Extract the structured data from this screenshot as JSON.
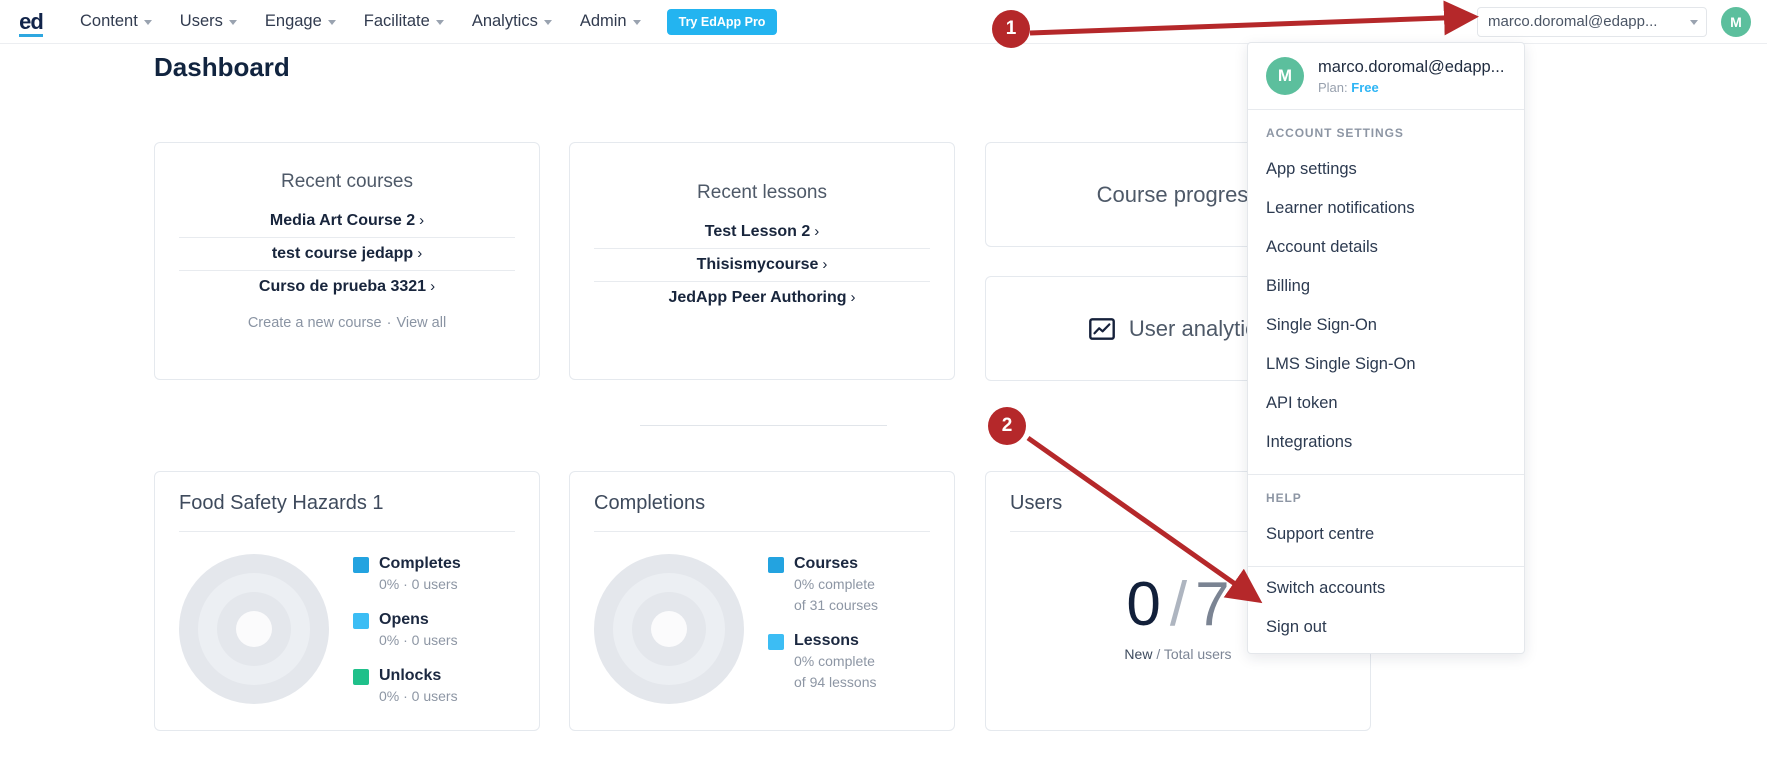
{
  "nav": {
    "logo": "ed",
    "items": [
      {
        "label": "Content",
        "has_caret": true
      },
      {
        "label": "Users",
        "has_caret": true
      },
      {
        "label": "Engage",
        "has_caret": true
      },
      {
        "label": "Facilitate",
        "has_caret": true
      },
      {
        "label": "Analytics",
        "has_caret": true
      },
      {
        "label": "Admin",
        "has_caret": true
      }
    ],
    "try_pro": "Try EdApp Pro",
    "account_selector_value": "marco.doromal@edapp...",
    "avatar_initial": "M"
  },
  "page": {
    "title": "Dashboard"
  },
  "recent_courses": {
    "heading": "Recent courses",
    "items": [
      {
        "label": "Media Art Course 2"
      },
      {
        "label": "test course jedapp"
      },
      {
        "label": "Curso de prueba 3321"
      }
    ],
    "create_link": "Create a new course",
    "separator": "·",
    "view_all_link": "View all"
  },
  "recent_lessons": {
    "heading": "Recent lessons",
    "items": [
      {
        "label": "Test Lesson 2"
      },
      {
        "label": "Thisismycourse"
      },
      {
        "label": "JedApp Peer Authoring"
      }
    ]
  },
  "course_progress": {
    "heading": "Course progress"
  },
  "user_analytics": {
    "heading": "User analytics",
    "icon": "chart-icon"
  },
  "food_safety": {
    "heading": "Food Safety Hazards 1",
    "legend": [
      {
        "label": "Completes",
        "sub": "0% · 0 users",
        "color": "#23a3e0"
      },
      {
        "label": "Opens",
        "sub": "0% · 0 users",
        "color": "#3cbdf4"
      },
      {
        "label": "Unlocks",
        "sub": "0% · 0 users",
        "color": "#1fc08a"
      }
    ]
  },
  "completions": {
    "heading": "Completions",
    "legend": [
      {
        "label": "Courses",
        "sub1": "0% complete",
        "sub2": "of 31 courses",
        "color": "#23a3e0"
      },
      {
        "label": "Lessons",
        "sub1": "0% complete",
        "sub2": "of 94 lessons",
        "color": "#3cbdf4"
      }
    ]
  },
  "users_card": {
    "heading": "Users",
    "new_count": "0",
    "slash": "/",
    "total_count": "7",
    "caption_new": "New",
    "caption_sep": " / ",
    "caption_total": "Total users"
  },
  "dropdown": {
    "avatar_initial": "M",
    "email": "marco.doromal@edapp...",
    "plan_label": "Plan:",
    "plan_value": "Free",
    "section_account": "ACCOUNT SETTINGS",
    "account_items": [
      {
        "label": "App settings"
      },
      {
        "label": "Learner notifications"
      },
      {
        "label": "Account details"
      },
      {
        "label": "Billing"
      },
      {
        "label": "Single Sign-On"
      },
      {
        "label": "LMS Single Sign-On"
      },
      {
        "label": "API token"
      },
      {
        "label": "Integrations"
      }
    ],
    "section_help": "HELP",
    "help_items": [
      {
        "label": "Support centre"
      }
    ],
    "bottom_items": [
      {
        "label": "Switch accounts"
      },
      {
        "label": "Sign out"
      }
    ]
  },
  "annotations": [
    {
      "number": "1"
    },
    {
      "number": "2"
    }
  ],
  "colors": {
    "accent": "#23b4f0",
    "brand_dark": "#11244a",
    "avatar_green": "#5cbf9d",
    "annotation_red": "#b5282a"
  }
}
